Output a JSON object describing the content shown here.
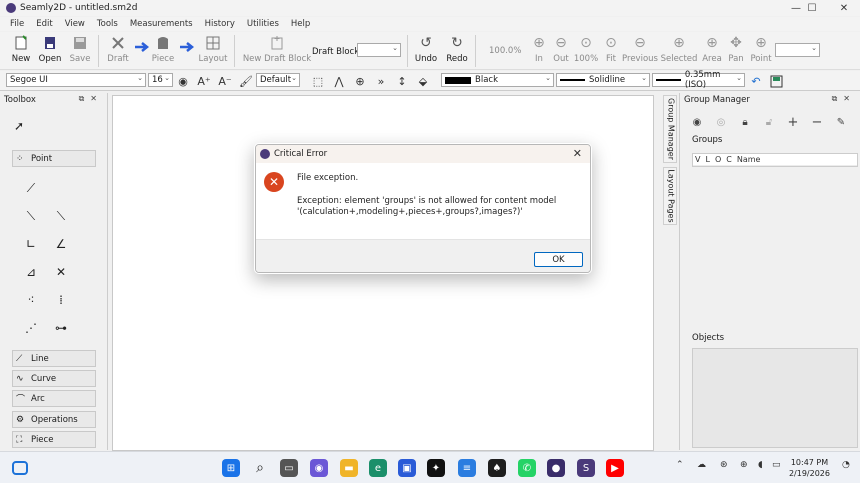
{
  "window": {
    "title": "Seamly2D - untitled.sm2d",
    "minimize": "—",
    "maximize": "☐",
    "close": "✕"
  },
  "menu": [
    "File",
    "Edit",
    "View",
    "Tools",
    "Measurements",
    "History",
    "Utilities",
    "Help"
  ],
  "toolbar": {
    "new": "New",
    "open": "Open",
    "save": "Save",
    "draft": "Draft",
    "piece": "Piece",
    "layout": "Layout",
    "new_draft_block": "New Draft Block",
    "draft_block_label": "Draft Block:",
    "undo": "Undo",
    "redo": "Redo",
    "zoom_value": "100.0%",
    "zoom_in": "In",
    "zoom_out": "Out",
    "zoom_100": "100%",
    "zoom_fit": "Fit",
    "zoom_previous": "Previous",
    "zoom_selected": "Selected",
    "zoom_area": "Area",
    "zoom_pan": "Pan",
    "zoom_point": "Point"
  },
  "toolbar2": {
    "font": "Segoe UI",
    "font_size": "16",
    "label_preset": "Default",
    "line_color": "Black",
    "line_type": "Solidline",
    "line_weight": "0.35mm (ISO)"
  },
  "toolbox": {
    "title": "Toolbox",
    "categories": {
      "point": "Point",
      "line": "Line",
      "curve": "Curve",
      "arc": "Arc",
      "operations": "Operations",
      "piece": "Piece"
    }
  },
  "right_tabs": {
    "group_manager": "Group Manager",
    "layout_pages": "Layout Pages"
  },
  "group_manager": {
    "title": "Group Manager",
    "groups_label": "Groups",
    "columns": [
      "V",
      "L",
      "O",
      "C",
      "Name"
    ],
    "objects_label": "Objects"
  },
  "dialog": {
    "title": "Critical Error",
    "message": "File exception.",
    "detail_line1": "Exception: element 'groups' is not allowed for content model",
    "detail_line2": "'(calculation+,modeling+,pieces+,groups?,images?)'",
    "ok": "OK"
  },
  "taskbar": {
    "time": "10:47 PM",
    "date": "2/19/2026"
  },
  "colors": {
    "accent": "#0067c0",
    "error": "#d9451f",
    "brand": "#4a3a7a"
  }
}
